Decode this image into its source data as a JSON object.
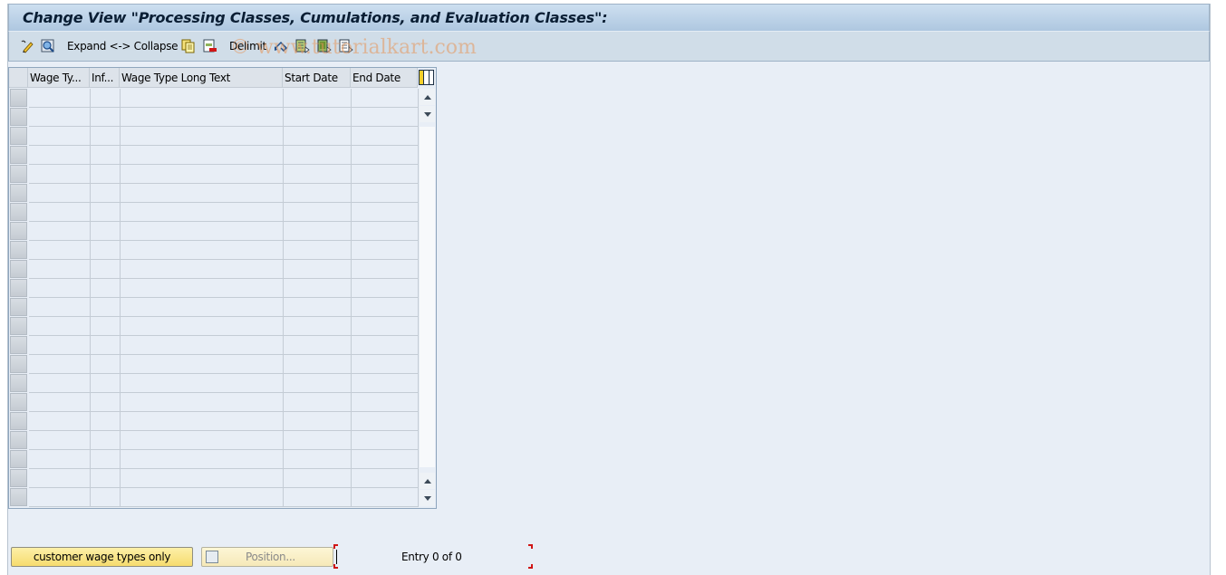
{
  "window": {
    "title": "Change View \"Processing Classes, Cumulations, and Evaluation Classes\":"
  },
  "toolbar": {
    "items": [
      {
        "icon": "display-change-icon"
      },
      {
        "icon": "find-icon"
      },
      {
        "label": "Expand <-> Collapse"
      },
      {
        "icon": "copy-icon"
      },
      {
        "icon": "delete-icon"
      },
      {
        "label": "Delimit"
      },
      {
        "icon": "undo-change-icon"
      },
      {
        "icon": "select-all-icon"
      },
      {
        "icon": "select-block-icon"
      },
      {
        "icon": "deselect-all-icon"
      }
    ]
  },
  "watermark": "© www.tutorialkart.com",
  "table": {
    "columns": [
      "Wage Ty...",
      "Inf...",
      "Wage Type Long Text",
      "Start Date",
      "End Date"
    ],
    "rows": [
      [
        "",
        "",
        "",
        "",
        ""
      ],
      [
        "",
        "",
        "",
        "",
        ""
      ],
      [
        "",
        "",
        "",
        "",
        ""
      ],
      [
        "",
        "",
        "",
        "",
        ""
      ],
      [
        "",
        "",
        "",
        "",
        ""
      ],
      [
        "",
        "",
        "",
        "",
        ""
      ],
      [
        "",
        "",
        "",
        "",
        ""
      ],
      [
        "",
        "",
        "",
        "",
        ""
      ],
      [
        "",
        "",
        "",
        "",
        ""
      ],
      [
        "",
        "",
        "",
        "",
        ""
      ],
      [
        "",
        "",
        "",
        "",
        ""
      ],
      [
        "",
        "",
        "",
        "",
        ""
      ],
      [
        "",
        "",
        "",
        "",
        ""
      ],
      [
        "",
        "",
        "",
        "",
        ""
      ],
      [
        "",
        "",
        "",
        "",
        ""
      ],
      [
        "",
        "",
        "",
        "",
        ""
      ],
      [
        "",
        "",
        "",
        "",
        ""
      ],
      [
        "",
        "",
        "",
        "",
        ""
      ],
      [
        "",
        "",
        "",
        "",
        ""
      ],
      [
        "",
        "",
        "",
        "",
        ""
      ],
      [
        "",
        "",
        "",
        "",
        ""
      ],
      [
        "",
        "",
        "",
        "",
        ""
      ]
    ]
  },
  "footer": {
    "customer_button": "customer wage types only",
    "position_button": "Position...",
    "entry_text": "Entry 0 of 0"
  }
}
